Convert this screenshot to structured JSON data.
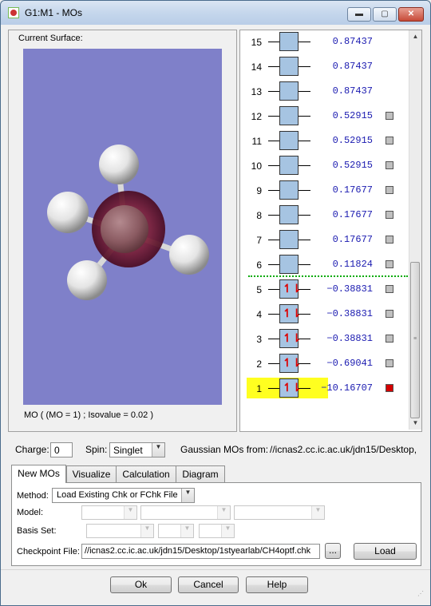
{
  "window": {
    "title": "G1:M1 - MOs",
    "minimize": "▬",
    "maximize": "▢",
    "close": "✕"
  },
  "surface": {
    "label": "Current Surface:",
    "caption": "MO ( (MO = 1) ; Isovalue = 0.02 )"
  },
  "orbitals": [
    {
      "num": "15",
      "energy": "0.87437",
      "occupied": false,
      "checkbox": false
    },
    {
      "num": "14",
      "energy": "0.87437",
      "occupied": false,
      "checkbox": false
    },
    {
      "num": "13",
      "energy": "0.87437",
      "occupied": false,
      "checkbox": false
    },
    {
      "num": "12",
      "energy": "0.52915",
      "occupied": false,
      "checkbox": true
    },
    {
      "num": "11",
      "energy": "0.52915",
      "occupied": false,
      "checkbox": true
    },
    {
      "num": "10",
      "energy": "0.52915",
      "occupied": false,
      "checkbox": true
    },
    {
      "num": "9",
      "energy": "0.17677",
      "occupied": false,
      "checkbox": true
    },
    {
      "num": "8",
      "energy": "0.17677",
      "occupied": false,
      "checkbox": true
    },
    {
      "num": "7",
      "energy": "0.17677",
      "occupied": false,
      "checkbox": true
    },
    {
      "num": "6",
      "energy": "0.11824",
      "occupied": false,
      "checkbox": true
    },
    {
      "num": "5",
      "energy": "−0.38831",
      "occupied": true,
      "checkbox": true
    },
    {
      "num": "4",
      "energy": "−0.38831",
      "occupied": true,
      "checkbox": true
    },
    {
      "num": "3",
      "energy": "−0.38831",
      "occupied": true,
      "checkbox": true
    },
    {
      "num": "2",
      "energy": "−0.69041",
      "occupied": true,
      "checkbox": true
    },
    {
      "num": "1",
      "energy": "−10.16707",
      "occupied": true,
      "checkbox": true,
      "selected": true
    }
  ],
  "spin_glyph": "↿⇂",
  "settings": {
    "charge_label": "Charge:",
    "charge_value": "0",
    "spin_label": "Spin:",
    "spin_value": "Singlet",
    "source_label": "Gaussian MOs from:",
    "source_path": "//icnas2.cc.ic.ac.uk/jdn15/Desktop,"
  },
  "tabs": [
    "New MOs",
    "Visualize",
    "Calculation",
    "Diagram"
  ],
  "new_mos": {
    "method_label": "Method:",
    "method_value": "Load Existing Chk or FChk File",
    "model_label": "Model:",
    "basis_label": "Basis Set:",
    "checkpoint_label": "Checkpoint File:",
    "checkpoint_value": "//icnas2.cc.ic.ac.uk/jdn15/Desktop/1styearlab/CH4optf.chk",
    "browse_label": "...",
    "load_label": "Load"
  },
  "footer": {
    "ok": "Ok",
    "cancel": "Cancel",
    "help": "Help"
  },
  "colors": {
    "viewer_bg": "#7f80c9",
    "highlight": "#ffff20",
    "energy_text": "#1a1ab0",
    "orbital_box": "#a6c4e2"
  }
}
